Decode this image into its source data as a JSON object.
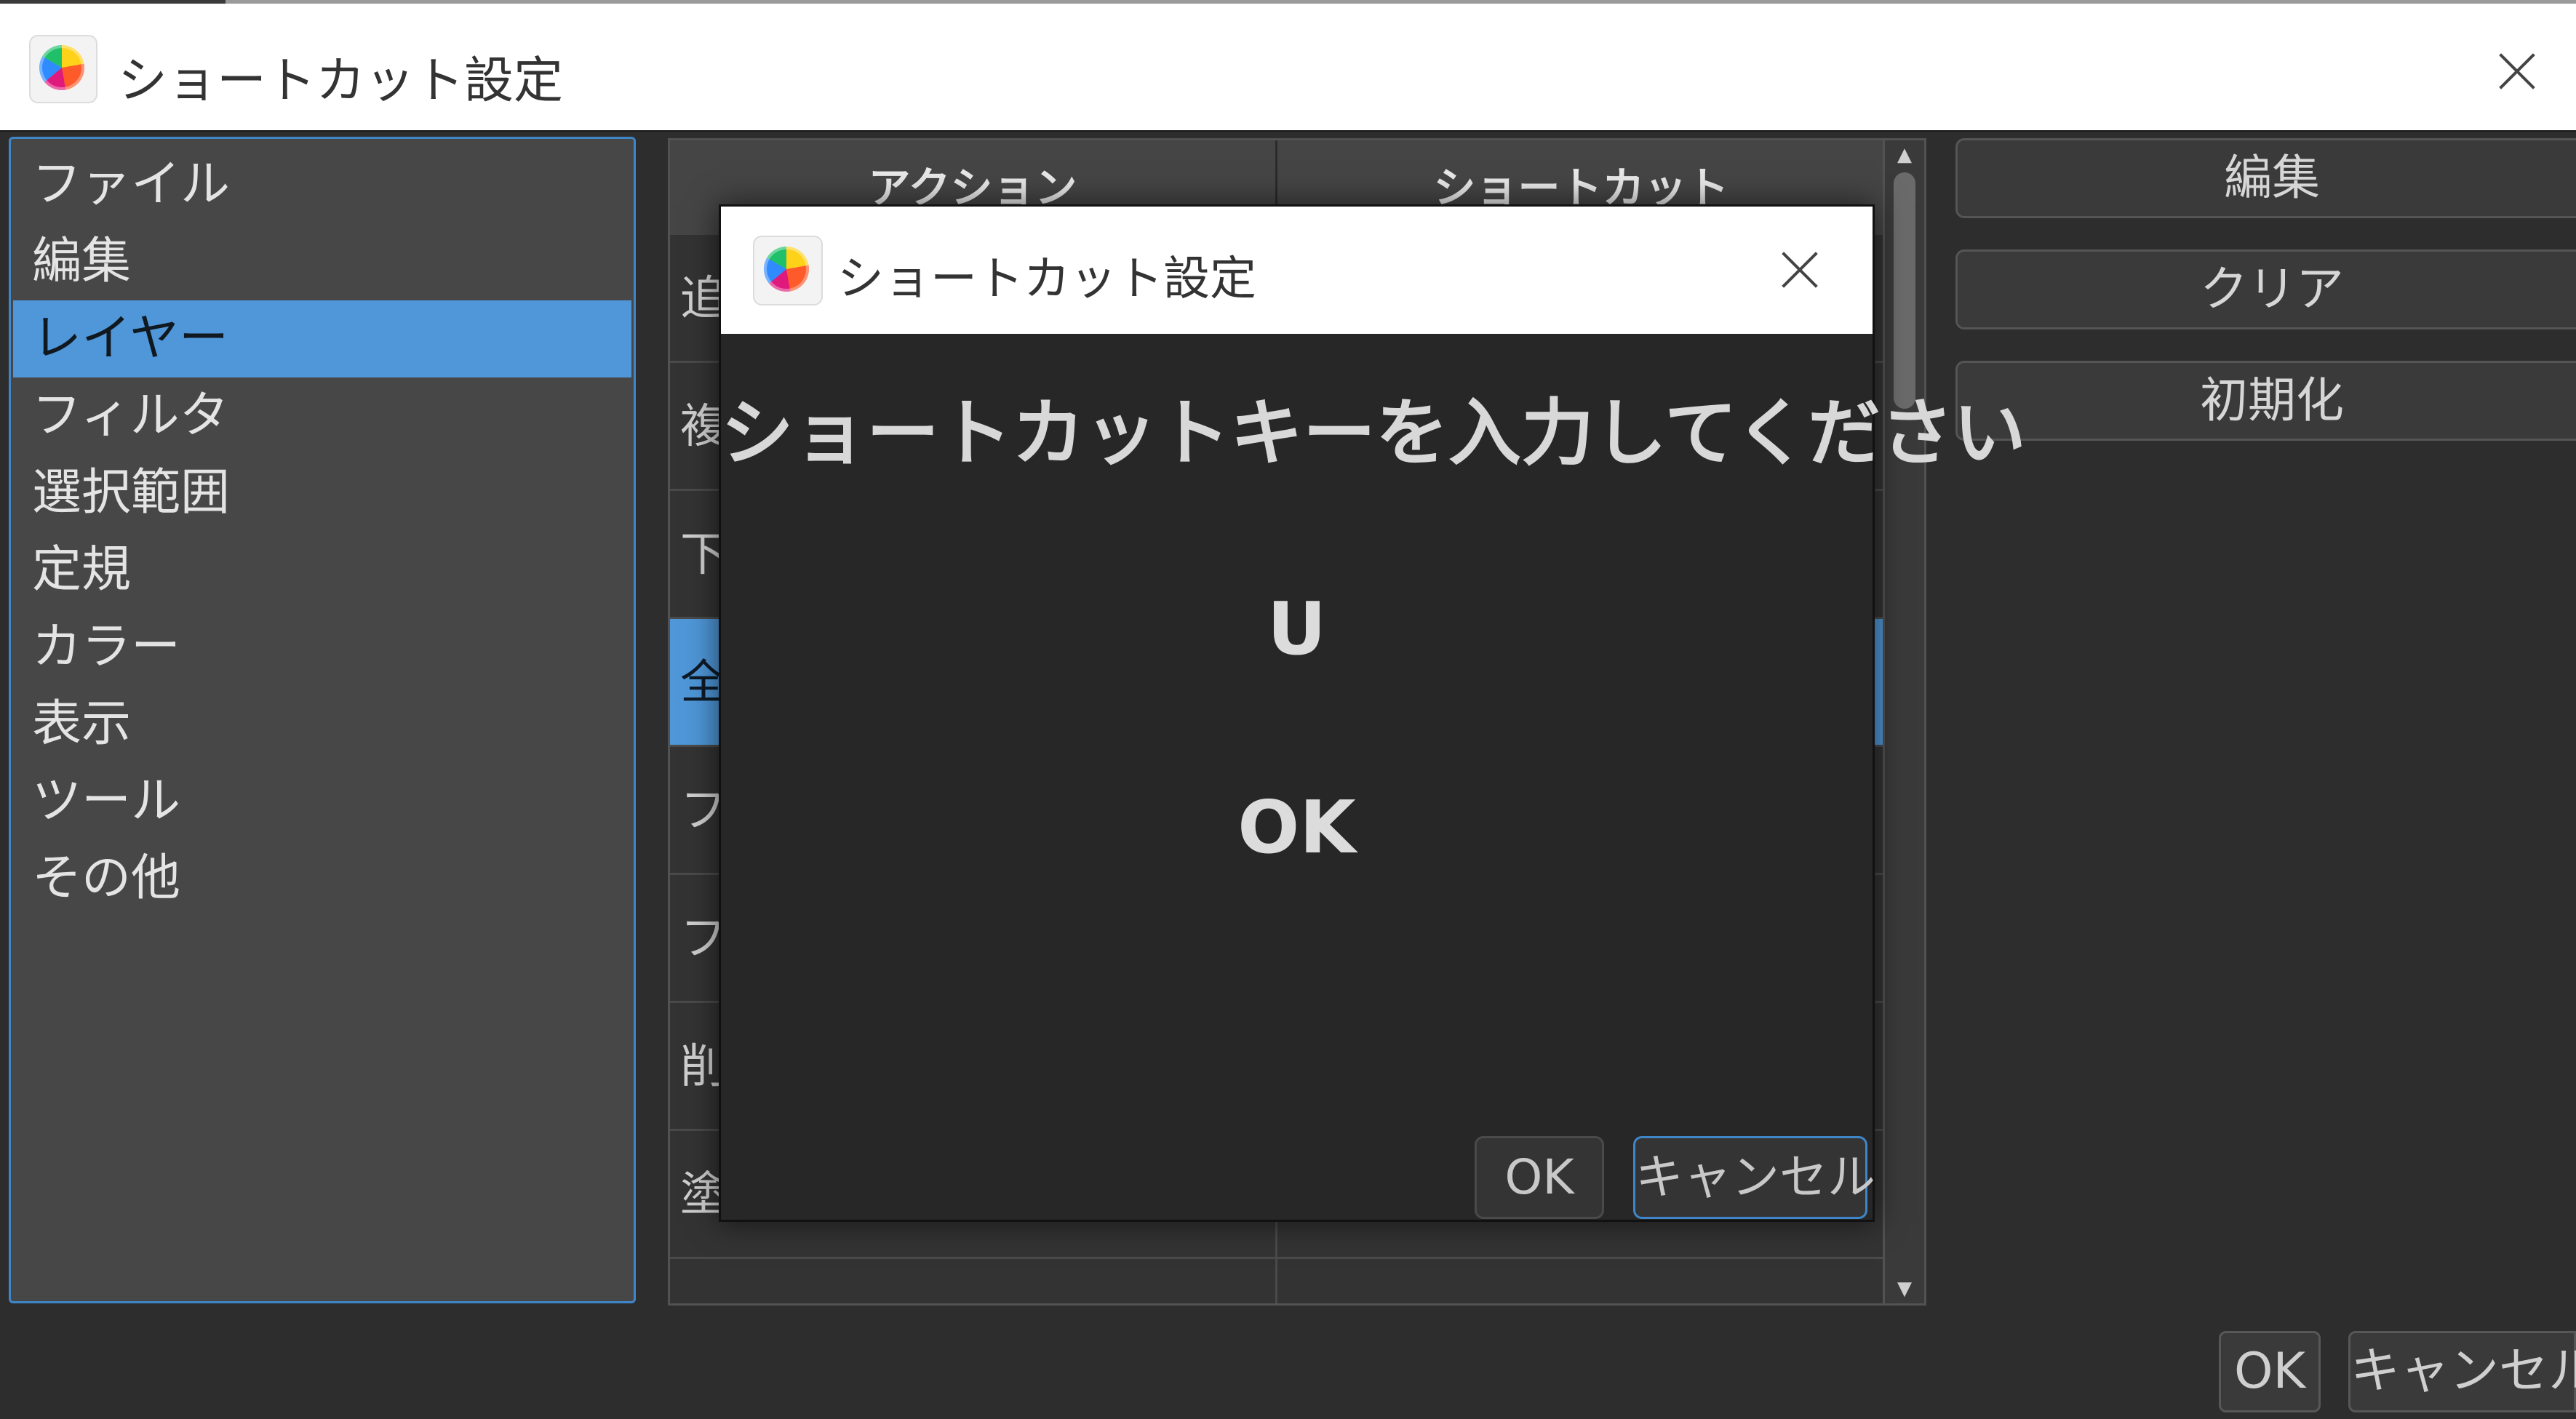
{
  "window": {
    "title": "ショートカット設定",
    "close_label": "close"
  },
  "categories": [
    {
      "label": "ファイル",
      "selected": false
    },
    {
      "label": "編集",
      "selected": false
    },
    {
      "label": "レイヤー",
      "selected": true
    },
    {
      "label": "フィルタ",
      "selected": false
    },
    {
      "label": "選択範囲",
      "selected": false
    },
    {
      "label": "定規",
      "selected": false
    },
    {
      "label": "カラー",
      "selected": false
    },
    {
      "label": "表示",
      "selected": false
    },
    {
      "label": "ツール",
      "selected": false
    },
    {
      "label": "その他",
      "selected": false
    }
  ],
  "table": {
    "headers": [
      "アクション",
      "ショートカット"
    ],
    "rows": [
      {
        "action": "追",
        "shortcut": ""
      },
      {
        "action": "複",
        "shortcut": ""
      },
      {
        "action": "下",
        "shortcut": ""
      },
      {
        "action": "全",
        "shortcut": "",
        "selected": true
      },
      {
        "action": "フ",
        "shortcut": ""
      },
      {
        "action": "フ",
        "shortcut": ""
      },
      {
        "action": "削",
        "shortcut": ""
      },
      {
        "action": "塗",
        "shortcut": ""
      },
      {
        "action": "",
        "shortcut": ""
      }
    ]
  },
  "side_buttons": {
    "edit": "編集",
    "clear": "クリア",
    "reset": "初期化"
  },
  "footer": {
    "ok": "OK",
    "cancel": "キャンセル"
  },
  "dialog": {
    "title": "ショートカット設定",
    "prompt": "ショートカットキーを入力してください",
    "key": "U",
    "status": "OK",
    "ok": "OK",
    "cancel": "キャンセル"
  },
  "colors": {
    "selection": "#4f97d8",
    "focus_border": "#3f86c9",
    "background": "#2d2d2d"
  }
}
